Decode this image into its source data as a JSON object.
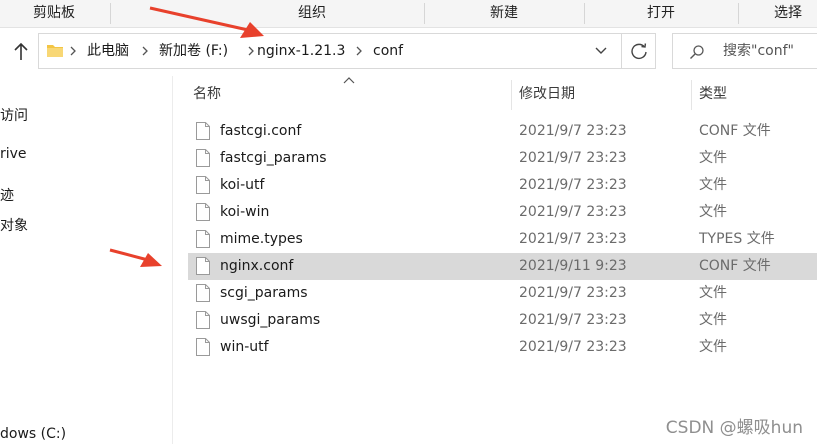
{
  "ribbon": {
    "groups": [
      "剪贴板",
      "组织",
      "新建",
      "打开",
      "选择"
    ]
  },
  "address": {
    "crumbs": [
      "此电脑",
      "新加卷 (F:)",
      "nginx-1.21.3",
      "conf"
    ]
  },
  "search": {
    "placeholder": "搜索\"conf\""
  },
  "nav": {
    "items": [
      "访问",
      "rive",
      "迹",
      "对象",
      "dows (C:)"
    ]
  },
  "columns": {
    "name": "名称",
    "modified": "修改日期",
    "type": "类型"
  },
  "files": [
    {
      "name": "fastcgi.conf",
      "modified": "2021/9/7 23:23",
      "type": "CONF 文件"
    },
    {
      "name": "fastcgi_params",
      "modified": "2021/9/7 23:23",
      "type": "文件"
    },
    {
      "name": "koi-utf",
      "modified": "2021/9/7 23:23",
      "type": "文件"
    },
    {
      "name": "koi-win",
      "modified": "2021/9/7 23:23",
      "type": "文件"
    },
    {
      "name": "mime.types",
      "modified": "2021/9/7 23:23",
      "type": "TYPES 文件"
    },
    {
      "name": "nginx.conf",
      "modified": "2021/9/11 9:23",
      "type": "CONF 文件"
    },
    {
      "name": "scgi_params",
      "modified": "2021/9/7 23:23",
      "type": "文件"
    },
    {
      "name": "uwsgi_params",
      "modified": "2021/9/7 23:23",
      "type": "文件"
    },
    {
      "name": "win-utf",
      "modified": "2021/9/7 23:23",
      "type": "文件"
    }
  ],
  "selected_file": "nginx.conf",
  "watermark": "CSDN @螺吸hun",
  "colors": {
    "selection": "#d9d9d9",
    "annotation_arrow": "#e8412c",
    "folder": "#f3c544"
  }
}
